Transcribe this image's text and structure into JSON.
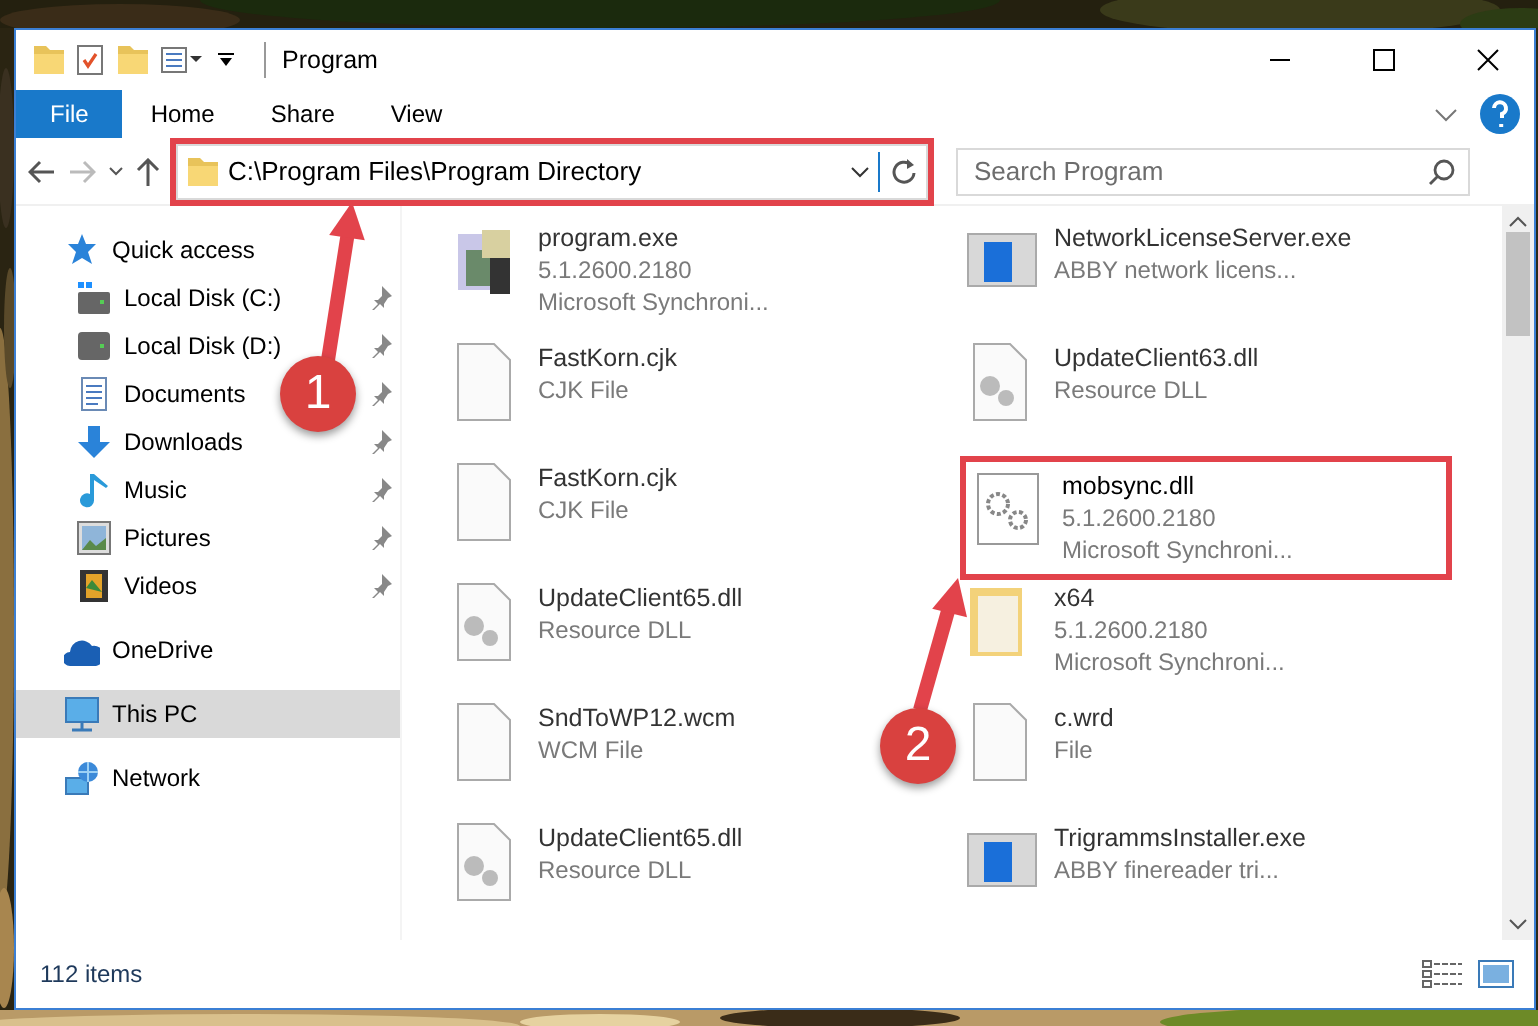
{
  "window": {
    "title": "Program"
  },
  "ribbon_tabs": [
    {
      "label": "File",
      "kind": "file"
    },
    {
      "label": "Home",
      "kind": "tab"
    },
    {
      "label": "Share",
      "kind": "tab"
    },
    {
      "label": "View",
      "kind": "tab"
    }
  ],
  "address_bar": {
    "path": "C:\\Program Files\\Program Directory",
    "highlighted": true
  },
  "search": {
    "placeholder": "Search Program"
  },
  "sidebar": {
    "items": [
      {
        "label": "Quick access",
        "selected": false,
        "children": [
          {
            "label": "Local Disk (C:)",
            "pinned": true
          },
          {
            "label": "Local Disk (D:)",
            "pinned": true
          },
          {
            "label": "Documents",
            "pinned": true
          },
          {
            "label": "Downloads",
            "pinned": true
          },
          {
            "label": "Music",
            "pinned": true
          },
          {
            "label": "Pictures",
            "pinned": true
          },
          {
            "label": "Videos",
            "pinned": true
          }
        ]
      },
      {
        "label": "OneDrive",
        "selected": false
      },
      {
        "label": "This PC",
        "selected": true
      },
      {
        "label": "Network",
        "selected": false
      }
    ]
  },
  "files": [
    {
      "name": "program.exe",
      "details": [
        "5.1.2600.2180",
        "Microsoft Synchroni..."
      ],
      "highlighted": false
    },
    {
      "name": "FastKorn.cjk",
      "details": [
        "CJK File"
      ],
      "highlighted": false
    },
    {
      "name": "FastKorn.cjk",
      "details": [
        "CJK File"
      ],
      "highlighted": false
    },
    {
      "name": "UpdateClient65.dll",
      "details": [
        "Resource DLL"
      ],
      "highlighted": false
    },
    {
      "name": "SndToWP12.wcm",
      "details": [
        "WCM File"
      ],
      "highlighted": false
    },
    {
      "name": "UpdateClient65.dll",
      "details": [
        "Resource DLL"
      ],
      "highlighted": false
    },
    {
      "name": "NetworkLicenseServer.exe",
      "details": [
        "ABBY network licens..."
      ],
      "highlighted": false
    },
    {
      "name": "UpdateClient63.dll",
      "details": [
        "Resource DLL"
      ],
      "highlighted": false
    },
    {
      "name": "mobsync.dll",
      "details": [
        "5.1.2600.2180",
        "Microsoft Synchroni..."
      ],
      "highlighted": true
    },
    {
      "name": "x64",
      "details": [
        "5.1.2600.2180",
        "Microsoft Synchroni..."
      ],
      "highlighted": false
    },
    {
      "name": "c.wrd",
      "details": [
        "File"
      ],
      "highlighted": false
    },
    {
      "name": "TrigrammsInstaller.exe",
      "details": [
        "ABBY finereader tri..."
      ],
      "highlighted": false
    }
  ],
  "status_bar": {
    "item_count": "112 items"
  },
  "callouts": [
    {
      "number": "1"
    },
    {
      "number": "2"
    }
  ]
}
